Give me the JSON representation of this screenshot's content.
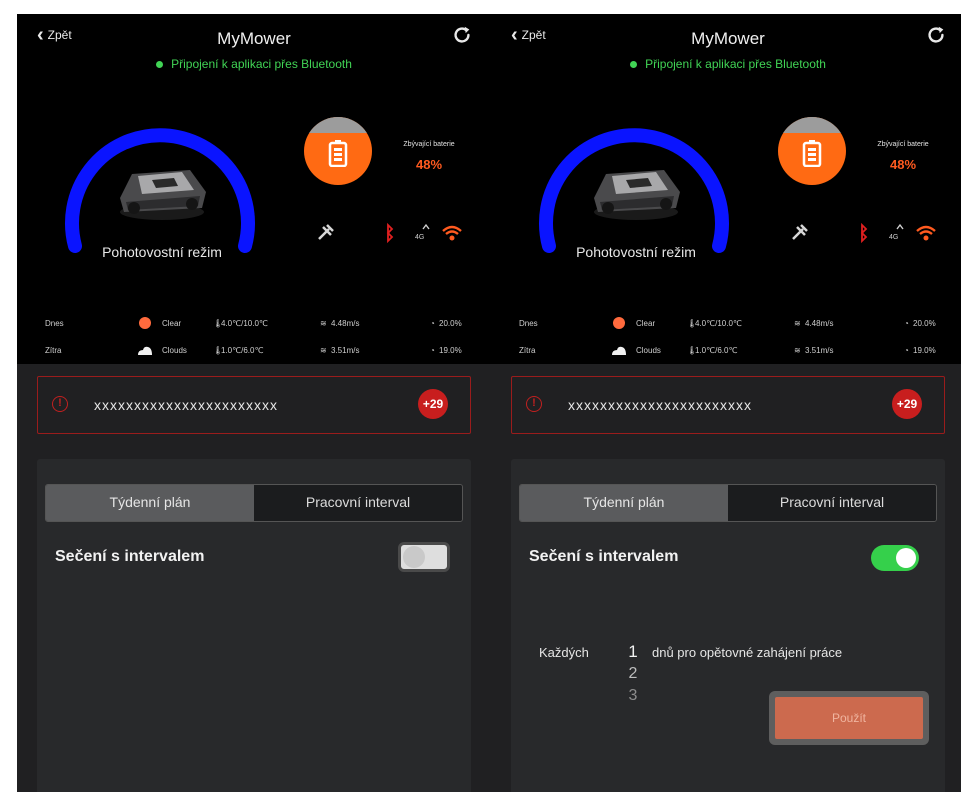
{
  "screens": [
    {
      "header": {
        "back_label": "Zpět",
        "title": "MyMower",
        "connection": "Připojení k aplikaci přes Bluetooth"
      },
      "mower": {
        "mode_label": "Pohotovostní režim"
      },
      "battery": {
        "label": "Zbývající baterie",
        "percent": "48%",
        "level": 0.48
      },
      "weather": [
        {
          "day": "Dnes",
          "condition": "Clear",
          "temp": "4.0℃/10.0℃",
          "wind": "4.48m/s",
          "humidity": "20.0%"
        },
        {
          "day": "Zítra",
          "condition": "Clouds",
          "temp": "1.0℃/6.0℃",
          "wind": "3.51m/s",
          "humidity": "19.0%"
        }
      ],
      "alert": {
        "message": "xxxxxxxxxxxxxxxxxxxxxxx",
        "badge": "+29"
      },
      "tabs": [
        {
          "label": "Týdenní plán"
        },
        {
          "label": "Pracovní interval"
        }
      ],
      "interval_switch": {
        "label": "Sečení s intervalem",
        "enabled": false
      }
    },
    {
      "header": {
        "back_label": "Zpět",
        "title": "MyMower",
        "connection": "Připojení k aplikaci přes Bluetooth"
      },
      "mower": {
        "mode_label": "Pohotovostní režim"
      },
      "battery": {
        "label": "Zbývající baterie",
        "percent": "48%",
        "level": 0.48
      },
      "weather": [
        {
          "day": "Dnes",
          "condition": "Clear",
          "temp": "4.0℃/10.0℃",
          "wind": "4.48m/s",
          "humidity": "20.0%"
        },
        {
          "day": "Zítra",
          "condition": "Clouds",
          "temp": "1.0℃/6.0℃",
          "wind": "3.51m/s",
          "humidity": "19.0%"
        }
      ],
      "alert": {
        "message": "xxxxxxxxxxxxxxxxxxxxxxx",
        "badge": "+29"
      },
      "tabs": [
        {
          "label": "Týdenní plán"
        },
        {
          "label": "Pracovní interval"
        }
      ],
      "interval_switch": {
        "label": "Sečení s intervalem",
        "enabled": true
      },
      "interval": {
        "prefix": "Každých",
        "suffix": "dnů pro opětovné zahájení práce",
        "options": [
          "1",
          "2",
          "3"
        ],
        "selected": "1"
      },
      "apply_label": "Použít"
    }
  ],
  "colors": {
    "gauge": "#0a14ff",
    "battery": "#ff6a13",
    "connected": "#41d455",
    "alert": "#c81e1e",
    "toggle_on": "#35d04b",
    "apply": "#cc6a4e"
  }
}
